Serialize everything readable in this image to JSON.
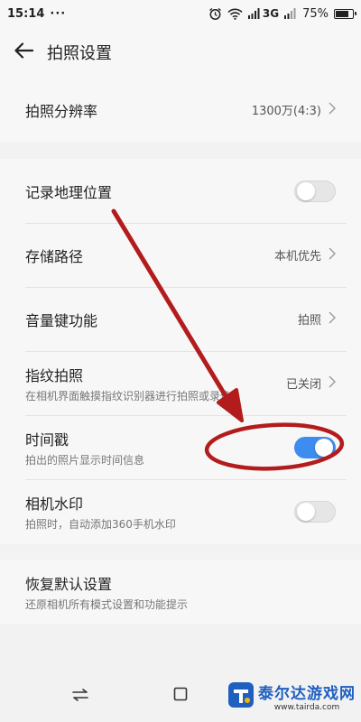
{
  "status_bar": {
    "time": "15:14",
    "dots": "···",
    "network": "3G",
    "battery": "75%",
    "battery_level": 0.75
  },
  "header": {
    "title": "拍照设置",
    "back_icon": "back-arrow-icon"
  },
  "settings": {
    "resolution": {
      "title": "拍照分辨率",
      "value": "1300万(4:3)"
    },
    "location": {
      "title": "记录地理位置",
      "enabled": false
    },
    "storage": {
      "title": "存储路径",
      "value": "本机优先"
    },
    "volume_key": {
      "title": "音量键功能",
      "value": "拍照"
    },
    "fingerprint": {
      "title": "指纹拍照",
      "subtitle": "在相机界面触摸指纹识别器进行拍照或录像",
      "value": "已关闭"
    },
    "timestamp": {
      "title": "时间戳",
      "subtitle": "拍出的照片显示时间信息",
      "enabled": true
    },
    "watermark": {
      "title": "相机水印",
      "subtitle": "拍照时，自动添加360手机水印",
      "enabled": false
    },
    "reset": {
      "title": "恢复默认设置",
      "subtitle": "还原相机所有模式设置和功能提示"
    }
  },
  "site_watermark": {
    "name": "泰尔达游戏网",
    "url": "www.tairda.com"
  },
  "colors": {
    "toggle_on": "#3d8cf0",
    "annotation_red": "#b31c1c"
  }
}
